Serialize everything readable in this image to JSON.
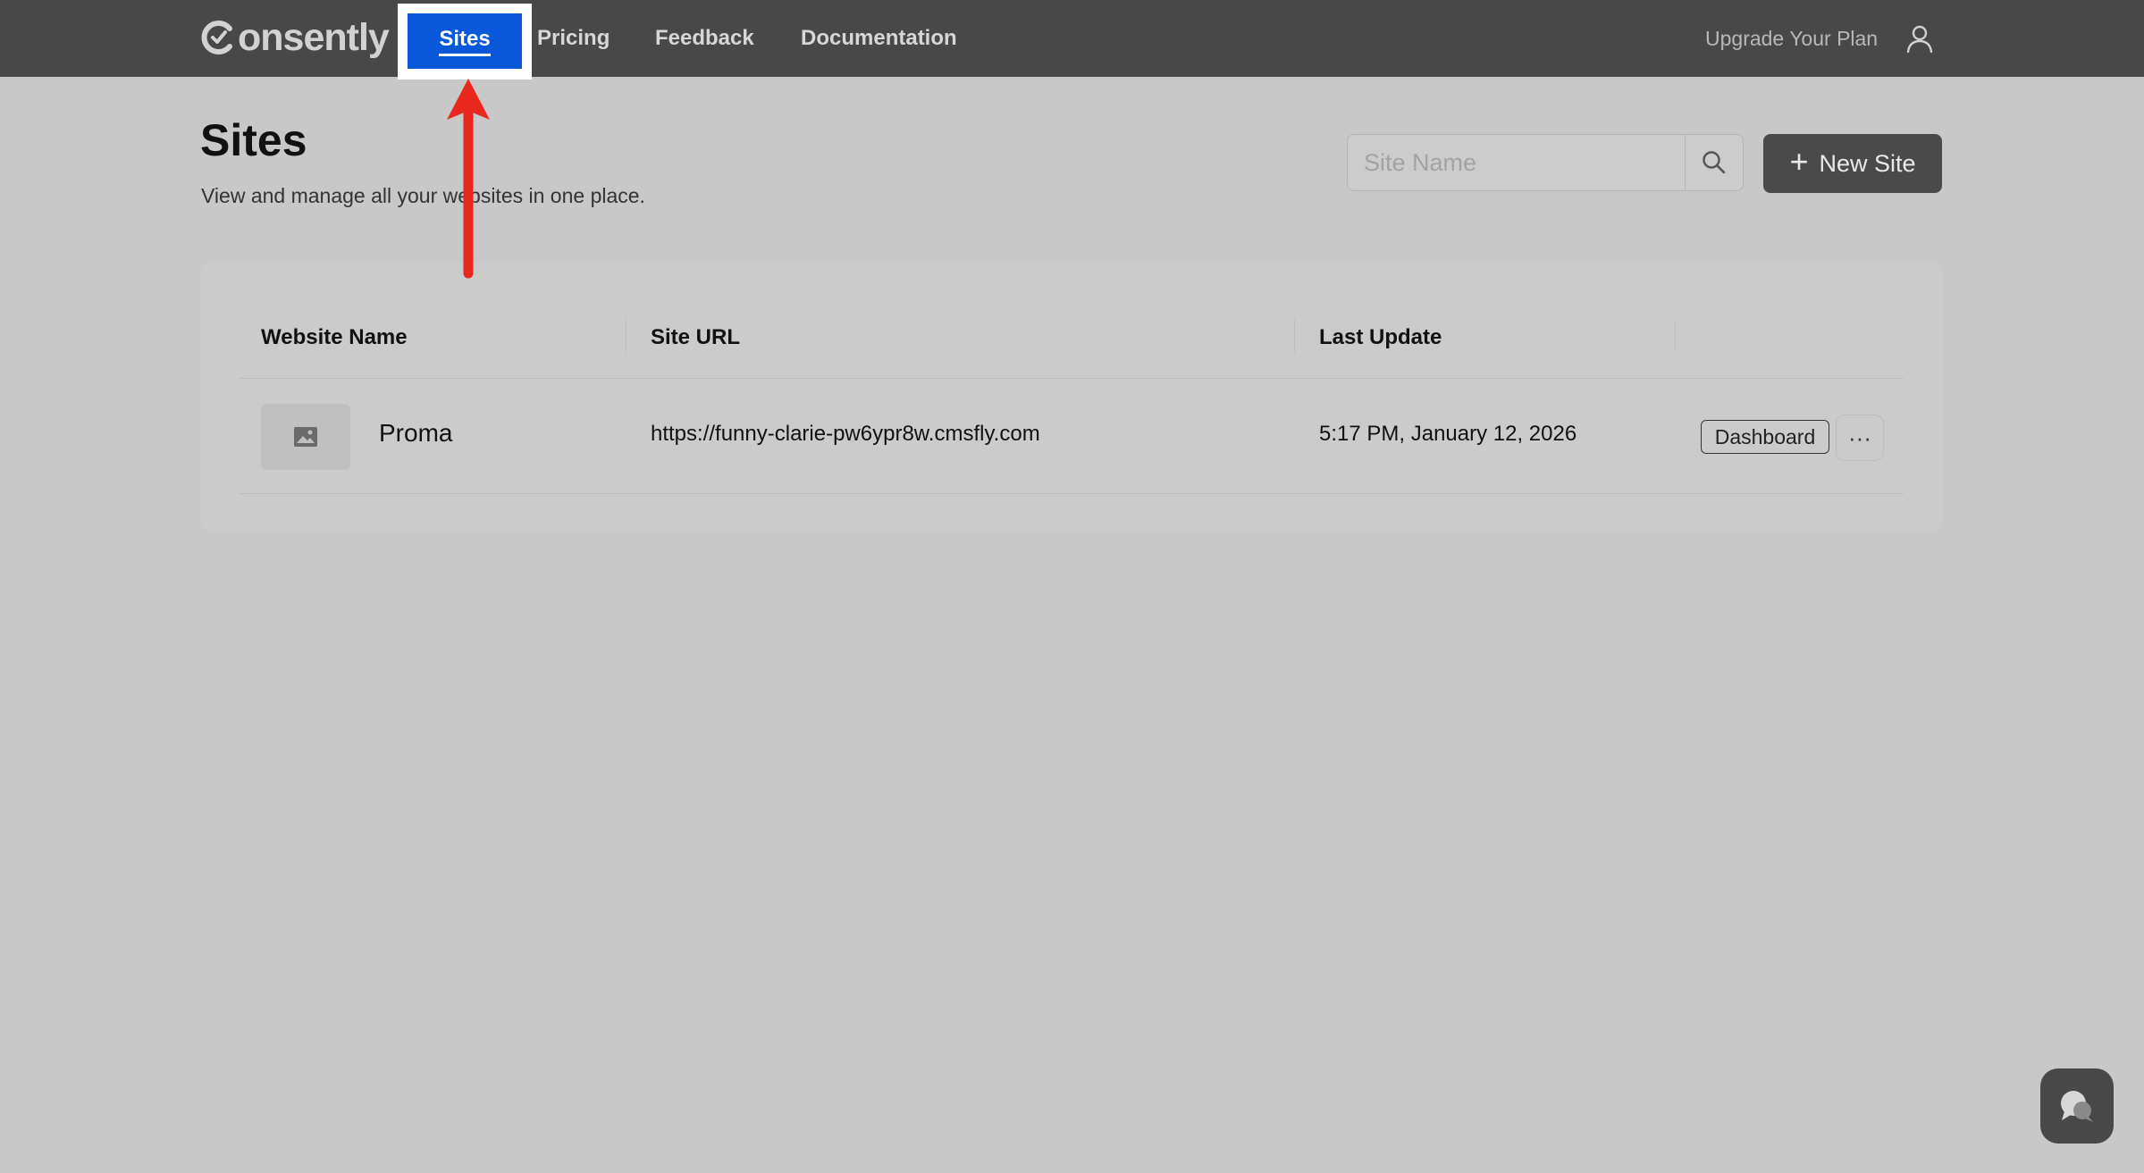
{
  "app": {
    "logo_text": "onsently",
    "logo_mark": "C"
  },
  "nav": {
    "items": [
      {
        "label": "Sites",
        "active": true
      },
      {
        "label": "Pricing"
      },
      {
        "label": "Feedback"
      },
      {
        "label": "Documentation"
      }
    ],
    "upgrade_label": "Upgrade Your Plan",
    "user_icon": "user-icon"
  },
  "header": {
    "title": "Sites",
    "subtitle": "View and manage all your websites in one place.",
    "search_placeholder": "Site Name",
    "search_value": "",
    "new_site_label": "New Site"
  },
  "table": {
    "columns": [
      "Website Name",
      "Site URL",
      "Last Update",
      ""
    ],
    "rows": [
      {
        "name": "Proma",
        "url": "https://funny-clarie-pw6ypr8w.cmsfly.com",
        "last_update": "5:17 PM, January 12, 2026",
        "action_label": "Dashboard",
        "more_label": "···"
      }
    ]
  },
  "colors": {
    "topbar": "#484848",
    "active_nav": "#0a58d9",
    "background": "#c8c8c8",
    "annotation_arrow": "#e8281c"
  }
}
